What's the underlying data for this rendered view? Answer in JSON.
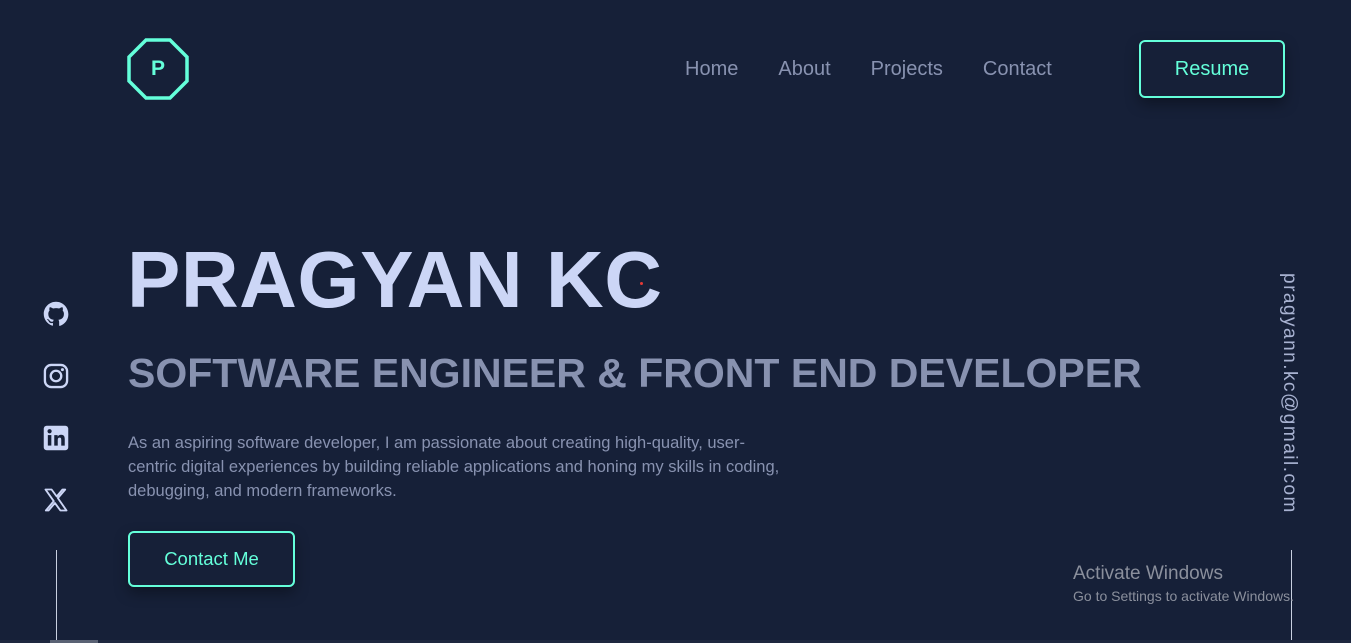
{
  "logo": {
    "letter": "P",
    "icon": "octagon-logo-icon"
  },
  "nav": {
    "items": [
      {
        "label": "Home"
      },
      {
        "label": "About"
      },
      {
        "label": "Projects"
      },
      {
        "label": "Contact"
      }
    ],
    "resume_label": "Resume"
  },
  "hero": {
    "name": "PRAGYAN KC",
    "role": "SOFTWARE ENGINEER & FRONT END DEVELOPER",
    "description": "As an aspiring software developer, I am passionate about creating high-quality, user-centric digital experiences by building reliable applications and honing my skills in coding, debugging, and modern frameworks.",
    "contact_label": "Contact Me"
  },
  "social": {
    "icons": [
      "github-icon",
      "instagram-icon",
      "linkedin-icon",
      "x-twitter-icon"
    ]
  },
  "email": "pragyann.kc@gmail.com",
  "watermark": {
    "title": "Activate Windows",
    "subtitle": "Go to Settings to activate Windows."
  },
  "colors": {
    "background": "#162038",
    "accent": "#64ffda",
    "heading": "#ccd6f6",
    "muted": "#8892b0"
  }
}
